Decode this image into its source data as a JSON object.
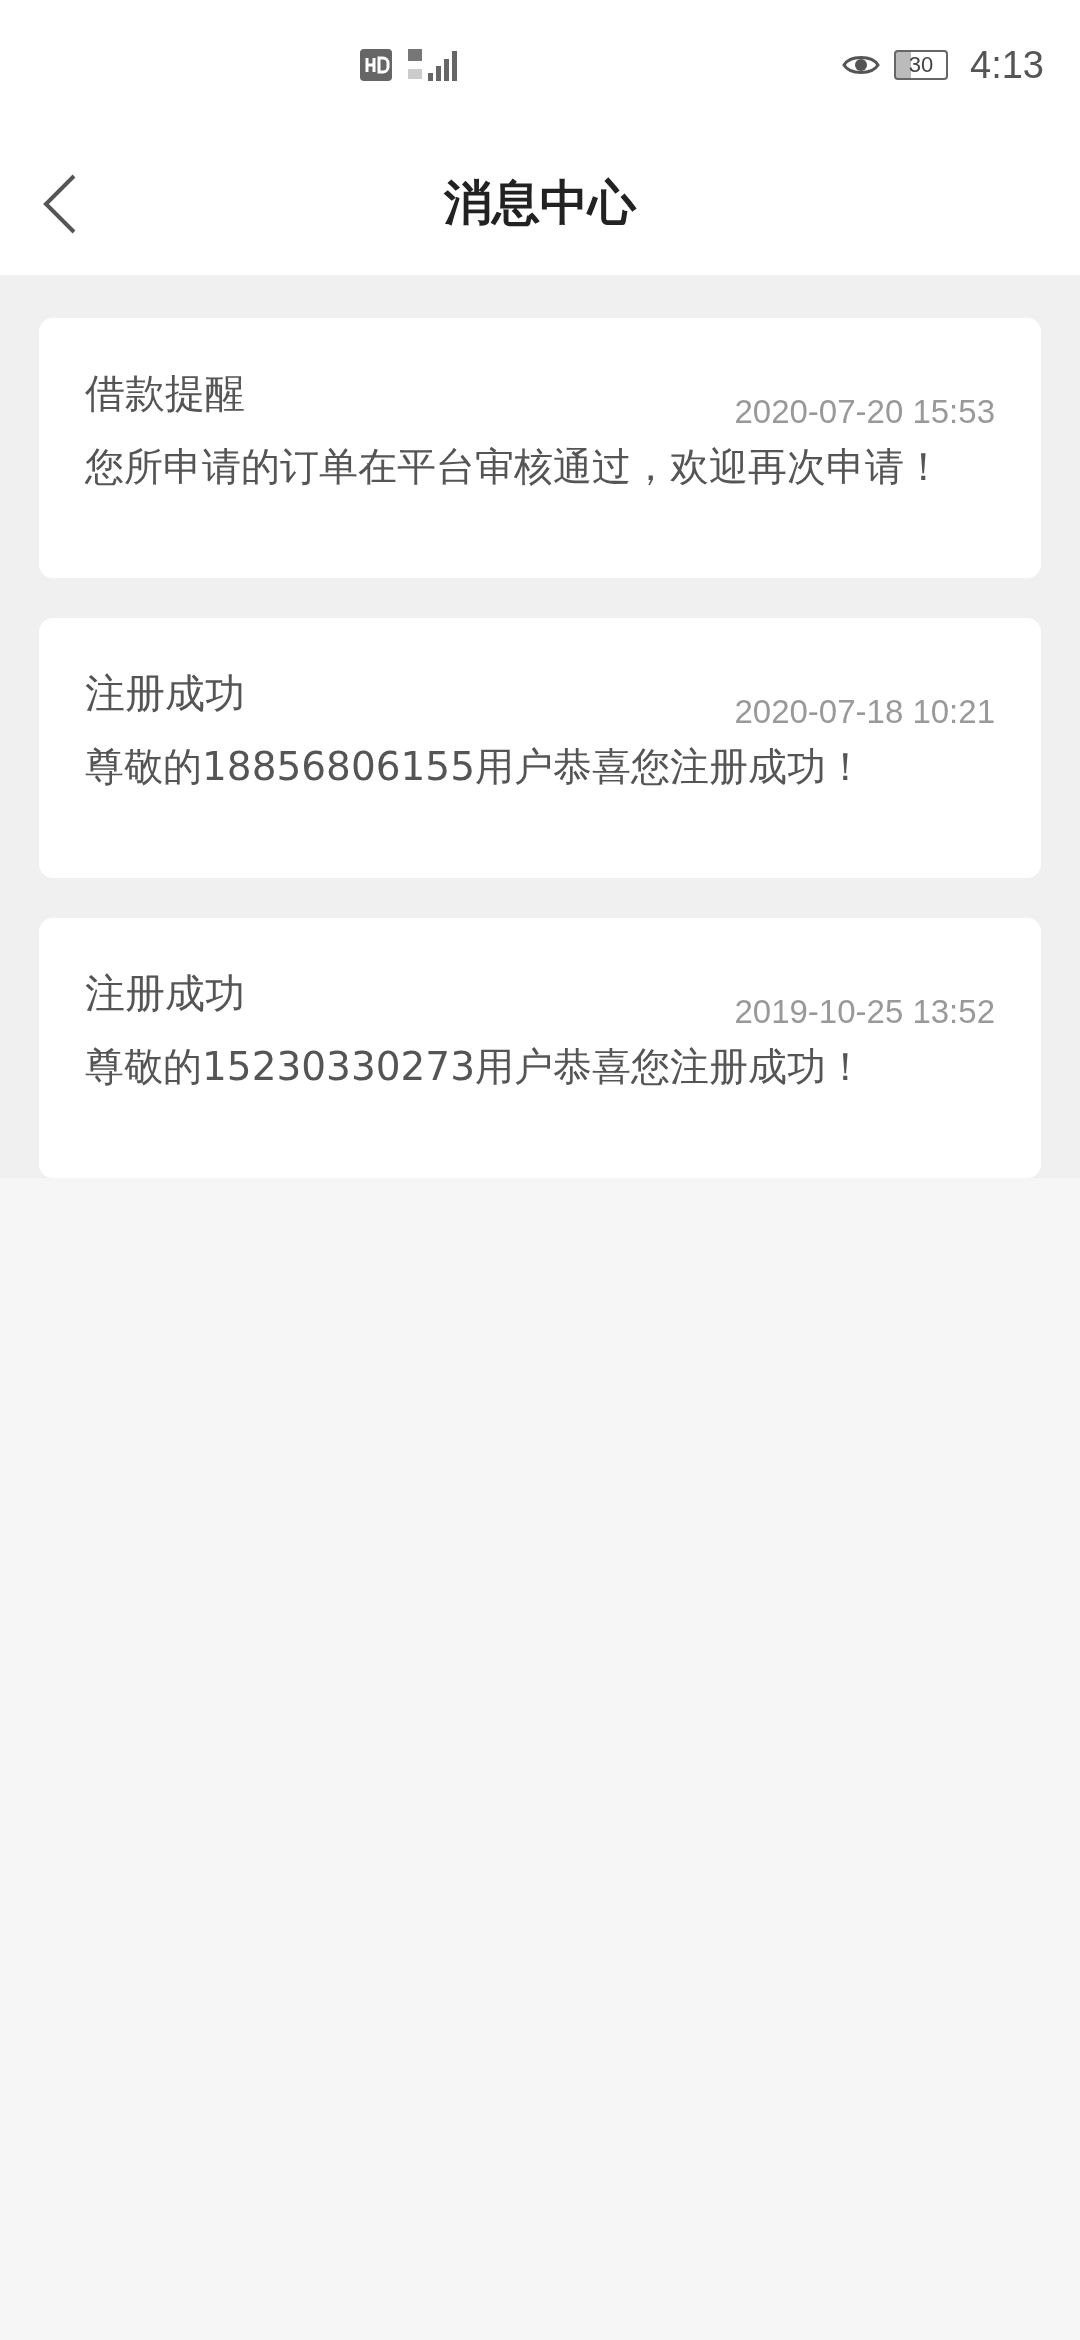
{
  "status_bar": {
    "battery": "30",
    "time": "4:13"
  },
  "header": {
    "title": "消息中心"
  },
  "messages": [
    {
      "title": "借款提醒",
      "time": "2020-07-20 15:53",
      "body": "您所申请的订单在平台审核通过，欢迎再次申请！"
    },
    {
      "title": "注册成功",
      "time": "2020-07-18 10:21",
      "body": "尊敬的18856806155用户恭喜您注册成功！"
    },
    {
      "title": "注册成功",
      "time": "2019-10-25 13:52",
      "body": "尊敬的15230330273用户恭喜您注册成功！"
    }
  ]
}
